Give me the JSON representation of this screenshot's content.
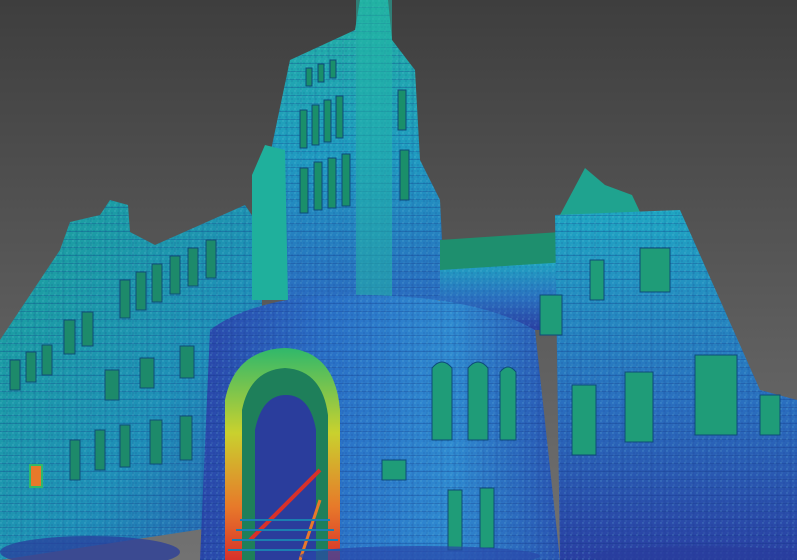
{
  "image": {
    "subject": "building-point-cloud-intensity-render",
    "palette": {
      "sky_top": "#3f3f3f",
      "sky_bottom": "#6e6e6e",
      "cyan": "#1fa5c4",
      "blue": "#2a63b5",
      "deep_blue": "#2a3d9c",
      "teal": "#1fa38f",
      "green": "#2fb86b",
      "yellow": "#c9d12e",
      "orange": "#e7792a",
      "red": "#d8312a"
    }
  }
}
